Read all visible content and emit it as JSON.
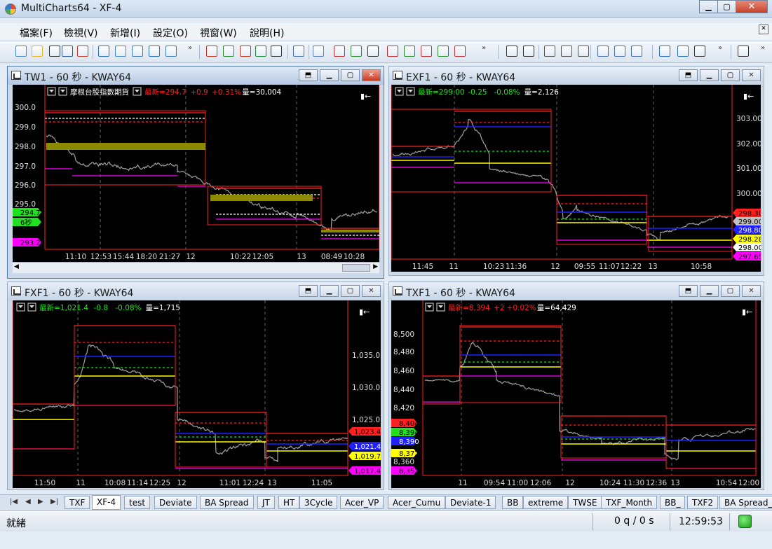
{
  "app": {
    "title": "MultiCharts64 - XF-4"
  },
  "menu": [
    "檔案(F)",
    "檢視(V)",
    "新增(I)",
    "設定(O)",
    "視窗(W)",
    "說明(H)"
  ],
  "windows": [
    {
      "title": "TW1 - 60 秒 - KWAY64",
      "instrument": "摩根台股指數期貨",
      "last_label": "最新=294.7",
      "change": "+0.9",
      "pct": "+0.31%",
      "vol": "量=30,004",
      "status_color": "#ff2020",
      "yaxis_side": "left",
      "ylabels": [
        "300.0",
        "299.0",
        "298.0",
        "297.0",
        "296.0",
        "295.0",
        "294.0",
        "293.0"
      ],
      "price_tags": [
        {
          "text": "294.7",
          "color": "#20e020"
        },
        {
          "text": "6秒",
          "color": "#20e020"
        },
        {
          "text": "293.2",
          "color": "#ff00ff"
        }
      ],
      "xlabels": [
        "11:10",
        "12:53",
        "15:44",
        "18:20",
        "21:27",
        "12",
        "10:22",
        "12:05",
        "13",
        "08:49",
        "10:28"
      ]
    },
    {
      "title": "EXF1 - 60 秒 - KWAY64",
      "instrument": "",
      "last_label": "最新=299.00",
      "change": "-0.25",
      "pct": "-0.08%",
      "vol": "量=2,126",
      "status_color": "#20e020",
      "yaxis_side": "right",
      "ylabels": [
        "303.00",
        "302.00",
        "301.00",
        "300.00",
        "299.00",
        "298.00"
      ],
      "price_tags": [
        {
          "text": "298.30",
          "color": "#ff2020"
        },
        {
          "text": "299.00",
          "color": "#bfbfbf"
        },
        {
          "text": "298.80",
          "color": "#2020ff"
        },
        {
          "text": "298.28",
          "color": "#ffff00"
        },
        {
          "text": "298.00",
          "color": "#ffffff"
        },
        {
          "text": "297.65",
          "color": "#ff00ff"
        }
      ],
      "xlabels": [
        "11:45",
        "11",
        "10:23",
        "11:36",
        "12",
        "09:55",
        "11:07",
        "12:22",
        "13",
        "10:58"
      ]
    },
    {
      "title": "FXF1 - 60 秒 - KWAY64",
      "instrument": "",
      "last_label": "最新=1,021.4",
      "change": "-0.8",
      "pct": "-0.08%",
      "vol": "量=1,715",
      "status_color": "#20e020",
      "yaxis_side": "right",
      "ylabels": [
        "1,035.0",
        "1,030.0",
        "1,025.0"
      ],
      "price_tags": [
        {
          "text": "1,023.4",
          "color": "#ff2020"
        },
        {
          "text": "1,021.4",
          "color": "#2020ff"
        },
        {
          "text": "1,019.7",
          "color": "#ffff00"
        },
        {
          "text": "1,017.4",
          "color": "#ff00ff"
        }
      ],
      "xlabels": [
        "11:50",
        "11",
        "10:08",
        "11:14",
        "12:25",
        "12",
        "11:01",
        "12:24",
        "13",
        "11:05"
      ]
    },
    {
      "title": "TXF1 - 60 秒 - KWAY64",
      "instrument": "",
      "last_label": "最新=8,394",
      "change": "+2",
      "pct": "+0.02%",
      "vol": "量=64,429",
      "status_color": "#ff2020",
      "yaxis_side": "left",
      "ylabels": [
        "8,500",
        "8,480",
        "8,460",
        "8,440",
        "8,420",
        "8,360"
      ],
      "price_tags": [
        {
          "text": "8,404",
          "color": "#ff2020"
        },
        {
          "text": "8,394",
          "color": "#20e020"
        },
        {
          "text": "8,390",
          "color": "#2020ff"
        },
        {
          "text": "8,372",
          "color": "#ffff00"
        },
        {
          "text": "8,352",
          "color": "#ff00ff"
        }
      ],
      "xlabels": [
        "11",
        "09:54",
        "11:00",
        "12:06",
        "12",
        "10:24",
        "11:30",
        "12:36",
        "13",
        "10:54",
        "12:00"
      ]
    }
  ],
  "tabs": [
    "TXF",
    "XF-4",
    "test",
    "Deviate",
    "BA Spread",
    "JT",
    "HT",
    "3Cycle",
    "Acer_VP",
    "Acer_Cumu",
    "Deviate-1",
    "BB",
    "extreme",
    "TWSE",
    "TXF_Month",
    "BB_",
    "TXF2",
    "BA Spread_2"
  ],
  "selected_tab": "XF-4",
  "status": {
    "ready": "就緒",
    "queue": "0 q / 0 s",
    "time": "12:59:53"
  },
  "colors": {
    "bg": "#000000",
    "price": "#a0a0a0",
    "red": "#ff2020",
    "blue": "#2020ff",
    "yellow": "#ffff00",
    "magenta": "#ff00ff",
    "green": "#20e020"
  }
}
